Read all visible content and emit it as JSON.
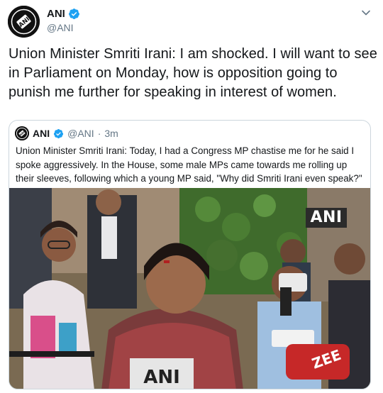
{
  "author": {
    "display_name": "ANI",
    "handle": "@ANI",
    "verified": true,
    "avatar_icon": "ani-logo-icon"
  },
  "tweet": {
    "text": "Union Minister Smriti Irani: I am shocked. I will want to see in Parliament on Monday, how is opposition going to punish me further for speaking in interest of women."
  },
  "quoted_tweet": {
    "display_name": "ANI",
    "handle": "@ANI",
    "separator": "·",
    "time": "3m",
    "verified": true,
    "text": "Union Minister Smriti Irani: Today, I had a Congress MP chastise me for he said I spoke aggressively. In the House, some male MPs came towards me rolling up their sleeves, following which a young MP said, \"Why did Smriti Irani even speak?\"",
    "media": {
      "watermark": "ANI",
      "mic_label": "ANI",
      "mic_label_2": "ZEE"
    }
  },
  "colors": {
    "verified_blue": "#1da1f2",
    "secondary_text": "#657786",
    "border": "#ccd6dd"
  }
}
